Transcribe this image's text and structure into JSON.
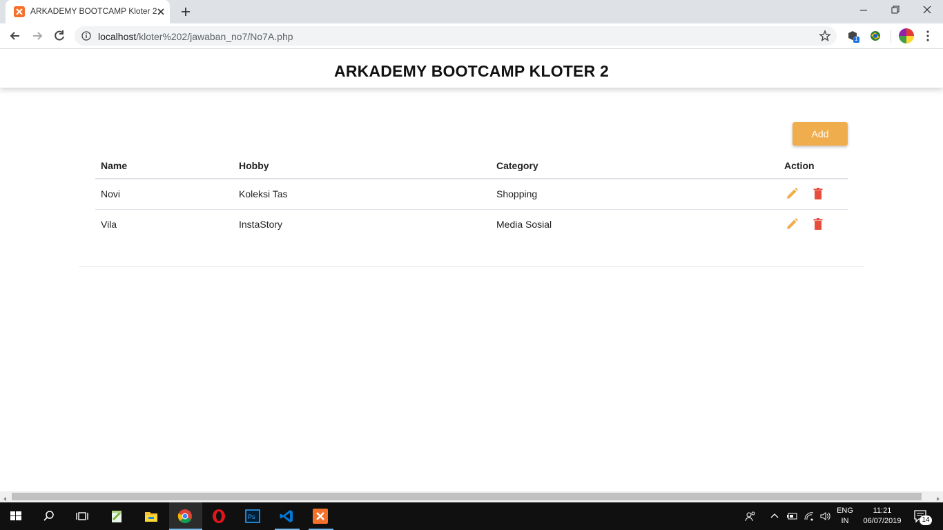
{
  "browser": {
    "tab_title": "ARKADEMY BOOTCAMP Kloter 2",
    "url_host": "localhost",
    "url_path": "/kloter%202/jawaban_no7/No7A.php",
    "extension_badge": "1"
  },
  "page": {
    "title": "ARKADEMY BOOTCAMP KLOTER 2",
    "add_label": "Add",
    "table": {
      "headers": {
        "name": "Name",
        "hobby": "Hobby",
        "category": "Category",
        "action": "Action"
      },
      "rows": [
        {
          "name": "Novi",
          "hobby": "Koleksi Tas",
          "category": "Shopping"
        },
        {
          "name": "Vila",
          "hobby": "InstaStory",
          "category": "Media Sosial"
        }
      ]
    },
    "colors": {
      "add_button": "#f0ad4e",
      "edit_icon": "#f0ad4e",
      "delete_icon": "#e74c3c"
    }
  },
  "taskbar": {
    "language_top": "ENG",
    "language_bottom": "IN",
    "time": "11:21",
    "date": "06/07/2019",
    "notification_count": "14",
    "apps": [
      "windows-start",
      "search",
      "task-view",
      "notepad-plus",
      "file-explorer",
      "chrome",
      "opera",
      "photoshop",
      "vscode",
      "xampp"
    ]
  }
}
